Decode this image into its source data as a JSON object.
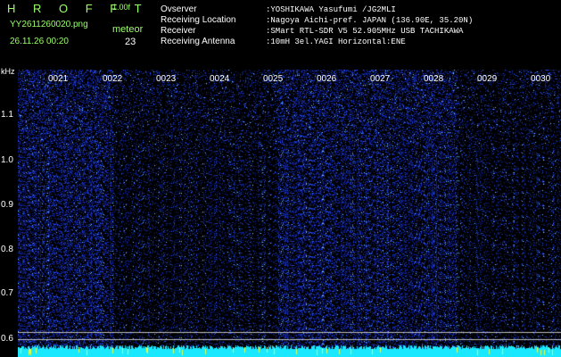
{
  "header": {
    "title": "H R O F F T",
    "version": "1.00f",
    "file_name": "YY2611260020.png",
    "meteor_label": "meteor",
    "datetime": "26.11.26 00:20",
    "meteor_count": "23"
  },
  "info": [
    {
      "key": "Ovserver",
      "value": ":YOSHIKAWA Yasufumi /JG2MLI"
    },
    {
      "key": "Receiving Location",
      "value": ":Nagoya Aichi-pref. JAPAN (136.90E, 35.20N)"
    },
    {
      "key": "Receiver",
      "value": ":SMart RTL-SDR V5 52.905MHz USB TACHIKAWA"
    },
    {
      "key": "Receiving Antenna",
      "value": ":10mH 3el.YAGI Horizontal:ENE"
    }
  ],
  "axis": {
    "unit": "kHz",
    "y_ticks": [
      "1.1",
      "1.0",
      "0.9",
      "0.8",
      "0.7",
      "0.6"
    ],
    "x_ticks": [
      "0021",
      "0022",
      "0023",
      "0024",
      "0025",
      "0026",
      "0027",
      "0028",
      "0029",
      "0030"
    ]
  },
  "colors": {
    "background": "#000000",
    "header_green": "#9cff6a",
    "noise_bright": "#2f4bff",
    "noise_dim": "#1d2a9a",
    "signal_cyan": "#19e8ff",
    "guide_line": "#bfbfbf"
  }
}
